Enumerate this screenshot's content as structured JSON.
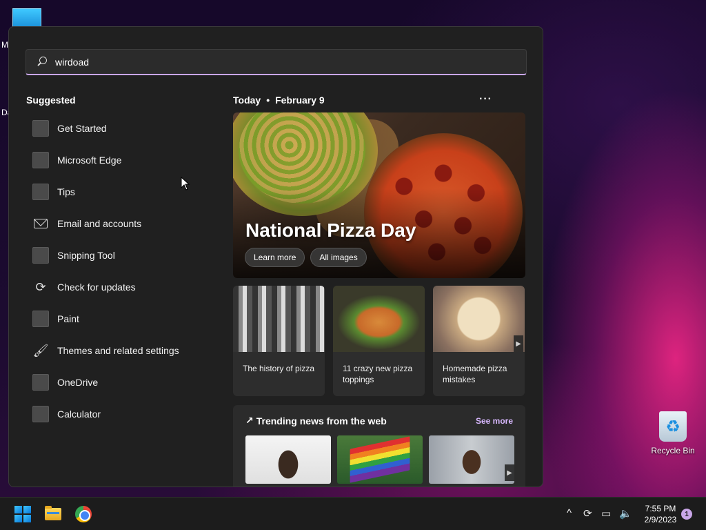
{
  "desktop": {
    "fragment_m": "M",
    "fragment_d": "Da",
    "recycle_bin_label": "Recycle Bin"
  },
  "search": {
    "value": "wirdoad"
  },
  "suggested": {
    "title": "Suggested",
    "items": [
      {
        "label": "Get Started",
        "icon": "app-tile-icon"
      },
      {
        "label": "Microsoft Edge",
        "icon": "app-tile-icon"
      },
      {
        "label": "Tips",
        "icon": "app-tile-icon"
      },
      {
        "label": "Email and accounts",
        "icon": "mail-icon"
      },
      {
        "label": "Snipping Tool",
        "icon": "app-tile-icon"
      },
      {
        "label": "Check for updates",
        "icon": "refresh-icon"
      },
      {
        "label": "Paint",
        "icon": "app-tile-icon"
      },
      {
        "label": "Themes and related settings",
        "icon": "brush-icon"
      },
      {
        "label": "OneDrive",
        "icon": "app-tile-icon"
      },
      {
        "label": "Calculator",
        "icon": "app-tile-icon"
      }
    ]
  },
  "today": {
    "label": "Today",
    "separator": "•",
    "date": "February 9",
    "more": "···"
  },
  "hero": {
    "title": "National Pizza Day",
    "learn_more": "Learn more",
    "all_images": "All images"
  },
  "cards": [
    {
      "text": "The history of pizza"
    },
    {
      "text": "11 crazy new pizza toppings"
    },
    {
      "text": "Homemade pizza mistakes"
    }
  ],
  "trending": {
    "title": "Trending news from the web",
    "see_more": "See more"
  },
  "taskbar": {
    "time": "7:55 PM",
    "date": "2/9/2023",
    "notification_count": "1"
  },
  "colors": {
    "accent": "#c9a6e8",
    "panel": "#202020",
    "taskbar": "#1c1c1c"
  }
}
